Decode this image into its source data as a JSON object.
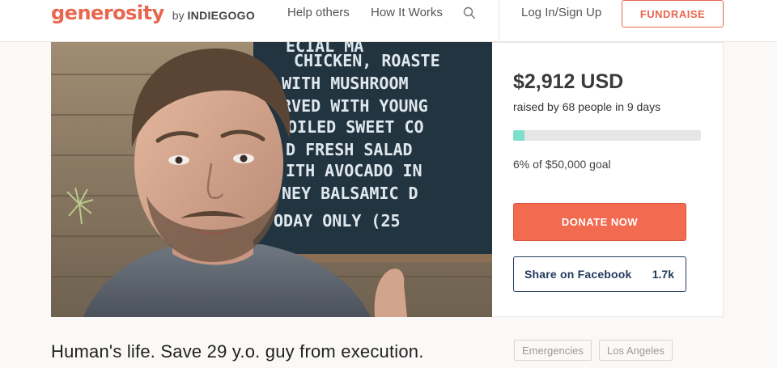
{
  "header": {
    "logo": "generosity",
    "by_prefix": "by",
    "by_brand": "INDIEGOGO",
    "nav": {
      "help_others": "Help others",
      "how_it_works": "How It Works",
      "login": "Log In/Sign Up",
      "fundraise": "FUNDRAISE"
    },
    "search_icon": "search-icon"
  },
  "hero": {
    "chalkboard_lines": [
      "ECIAL MA",
      "CHICKEN, ROASTE",
      "WITH MUSHROOM",
      "RVED WITH YOUNG",
      "OILED SWEET CO",
      "D FRESH SALAD",
      "ITH AVOCADO IN",
      "NEY BALSAMIC D",
      "ODAY ONLY (25"
    ]
  },
  "campaign": {
    "amount": "$2,912 USD",
    "raised_text": "raised by 68 people in 9 days",
    "progress_fraction": 0.06,
    "goal_text": "6% of $50,000 goal",
    "donate_label": "DONATE NOW",
    "share_label": "Share on Facebook",
    "share_count": "1.7k",
    "title": "Human's life. Save 29 y.o. guy from execution.",
    "tags": [
      "Emergencies",
      "Los Angeles"
    ]
  },
  "colors": {
    "brand": "#e8664e",
    "donate": "#f26a4f",
    "progress": "#7ee0cc",
    "facebook_text": "#233a5e"
  }
}
